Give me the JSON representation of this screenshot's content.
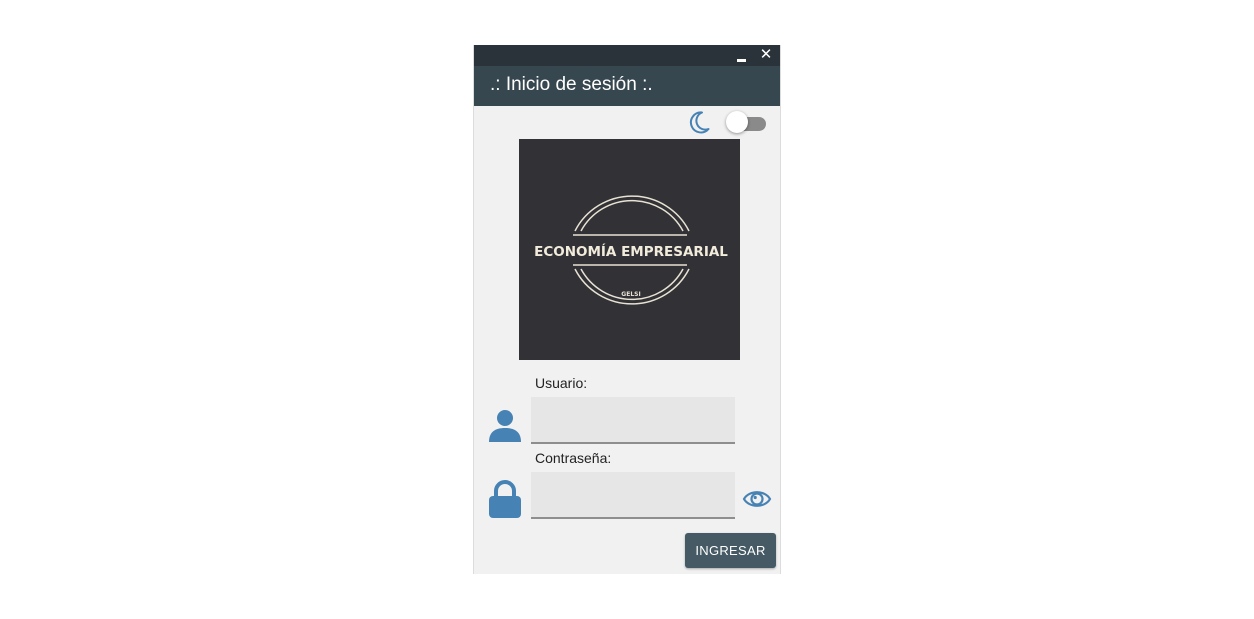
{
  "window": {
    "title": ".: Inicio de sesión :.",
    "minimize_icon": "minimize-icon",
    "close_label": "✕"
  },
  "theme": {
    "mode_icon": "moon-icon",
    "dark_mode_enabled": false,
    "header_color": "#37474f",
    "accent_color": "#4682b4"
  },
  "logo": {
    "name": "ECONOMÍA EMPRESARIAL",
    "sub": "GELSI"
  },
  "form": {
    "user_label": "Usuario:",
    "user_value": "",
    "password_label": "Contraseña:",
    "password_value": "",
    "show_password_icon": "eye-icon",
    "submit_label": "INGRESAR"
  }
}
